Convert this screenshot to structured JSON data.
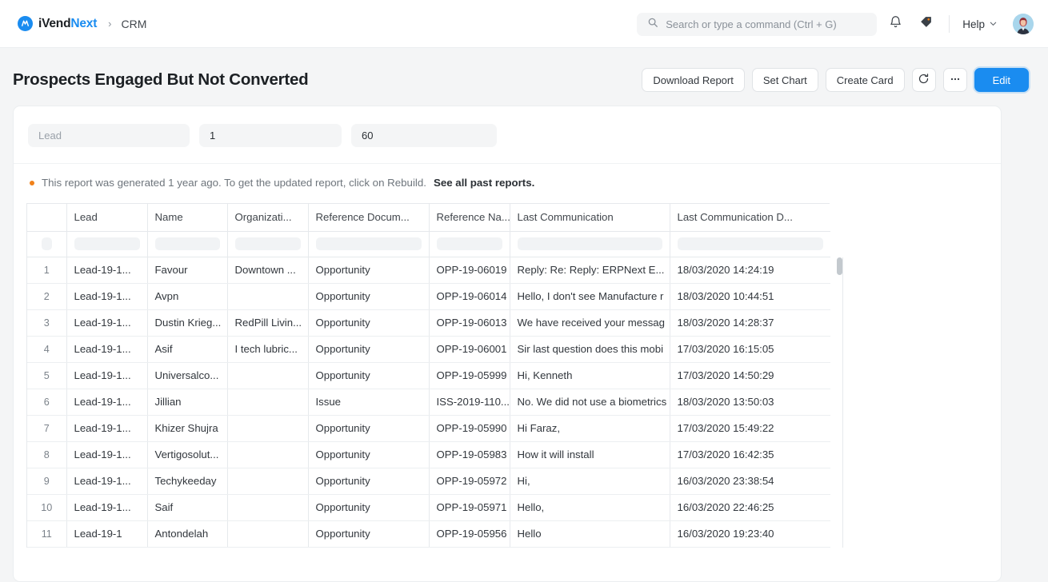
{
  "navbar": {
    "brand_first": "iVend",
    "brand_second": "Next",
    "breadcrumb_separator": "›",
    "breadcrumb": "CRM",
    "search_placeholder": "Search or type a command (Ctrl + G)",
    "search_value": "",
    "icons": [
      "search-icon",
      "bell-icon",
      "tag-icon"
    ],
    "help_label": "Help",
    "avatar_alt": "user-avatar"
  },
  "page": {
    "title": "Prospects Engaged But Not Converted",
    "actions": [
      {
        "label": "Download Report",
        "name": "download-report-button",
        "style": "default"
      },
      {
        "label": "Set Chart",
        "name": "set-chart-button",
        "style": "default"
      },
      {
        "label": "Create Card",
        "name": "create-card-button",
        "style": "default"
      },
      {
        "label": "",
        "name": "refresh-button",
        "style": "icon-refresh"
      },
      {
        "label": "",
        "name": "more-options-button",
        "style": "icon-ellipsis"
      },
      {
        "label": "Edit",
        "name": "edit-button",
        "style": "primary"
      }
    ],
    "accent_color": "#1a8cf0"
  },
  "filters": [
    {
      "name": "lead-filter",
      "placeholder": "Lead",
      "value": ""
    },
    {
      "name": "from-filter",
      "placeholder": "",
      "value": "1"
    },
    {
      "name": "to-filter",
      "placeholder": "",
      "value": "60"
    }
  ],
  "notice": {
    "text": "This report was generated 1 year ago. To get the updated report, click on Rebuild.",
    "link": "See all past reports.",
    "dot_color": "#f0811a"
  },
  "table": {
    "columns": [
      "",
      "Lead",
      "Name",
      "Organizati...",
      "Reference Docum...",
      "Reference Na...",
      "Last Communication",
      "Last Communication D..."
    ],
    "rows": [
      {
        "n": "1",
        "lead": "Lead-19-1...",
        "name": "Favour",
        "org": "Downtown ...",
        "refdoc": "Opportunity",
        "refname": "OPP-19-06019",
        "comm": "Reply: Re: Reply: ERPNext E...",
        "date": "18/03/2020 14:24:19"
      },
      {
        "n": "2",
        "lead": "Lead-19-1...",
        "name": "Avpn",
        "org": "",
        "refdoc": "Opportunity",
        "refname": "OPP-19-06014",
        "comm": "Hello, I don't see Manufacture r",
        "date": "18/03/2020 10:44:51"
      },
      {
        "n": "3",
        "lead": "Lead-19-1...",
        "name": "Dustin Krieg...",
        "org": "RedPill Livin...",
        "refdoc": "Opportunity",
        "refname": "OPP-19-06013",
        "comm": "We have received your messag",
        "date": "18/03/2020 14:28:37"
      },
      {
        "n": "4",
        "lead": "Lead-19-1...",
        "name": "Asif",
        "org": "I tech lubric...",
        "refdoc": "Opportunity",
        "refname": "OPP-19-06001",
        "comm": "Sir last question does this mobi",
        "date": "17/03/2020 16:15:05"
      },
      {
        "n": "5",
        "lead": "Lead-19-1...",
        "name": "Universalco...",
        "org": "",
        "refdoc": "Opportunity",
        "refname": "OPP-19-05999",
        "comm": "Hi,  Kenneth",
        "date": "17/03/2020 14:50:29"
      },
      {
        "n": "6",
        "lead": "Lead-19-1...",
        "name": "Jillian",
        "org": "",
        "refdoc": "Issue",
        "refname": "ISS-2019-110...",
        "comm": "No. We did not use a biometrics",
        "date": "18/03/2020 13:50:03"
      },
      {
        "n": "7",
        "lead": "Lead-19-1...",
        "name": "Khizer Shujra",
        "org": "",
        "refdoc": "Opportunity",
        "refname": "OPP-19-05990",
        "comm": "Hi Faraz,",
        "date": "17/03/2020 15:49:22"
      },
      {
        "n": "8",
        "lead": "Lead-19-1...",
        "name": "Vertigosolut...",
        "org": "",
        "refdoc": "Opportunity",
        "refname": "OPP-19-05983",
        "comm": "How it will install",
        "date": "17/03/2020 16:42:35"
      },
      {
        "n": "9",
        "lead": "Lead-19-1...",
        "name": "Techykeeday",
        "org": "",
        "refdoc": "Opportunity",
        "refname": "OPP-19-05972",
        "comm": "Hi,",
        "date": "16/03/2020 23:38:54"
      },
      {
        "n": "10",
        "lead": "Lead-19-1...",
        "name": "Saif",
        "org": "",
        "refdoc": "Opportunity",
        "refname": "OPP-19-05971",
        "comm": "Hello,",
        "date": "16/03/2020 22:46:25"
      },
      {
        "n": "11",
        "lead": "Lead-19-1",
        "name": "Antondelah",
        "org": "",
        "refdoc": "Opportunity",
        "refname": "OPP-19-05956",
        "comm": "Hello",
        "date": "16/03/2020 19:23:40"
      }
    ]
  }
}
